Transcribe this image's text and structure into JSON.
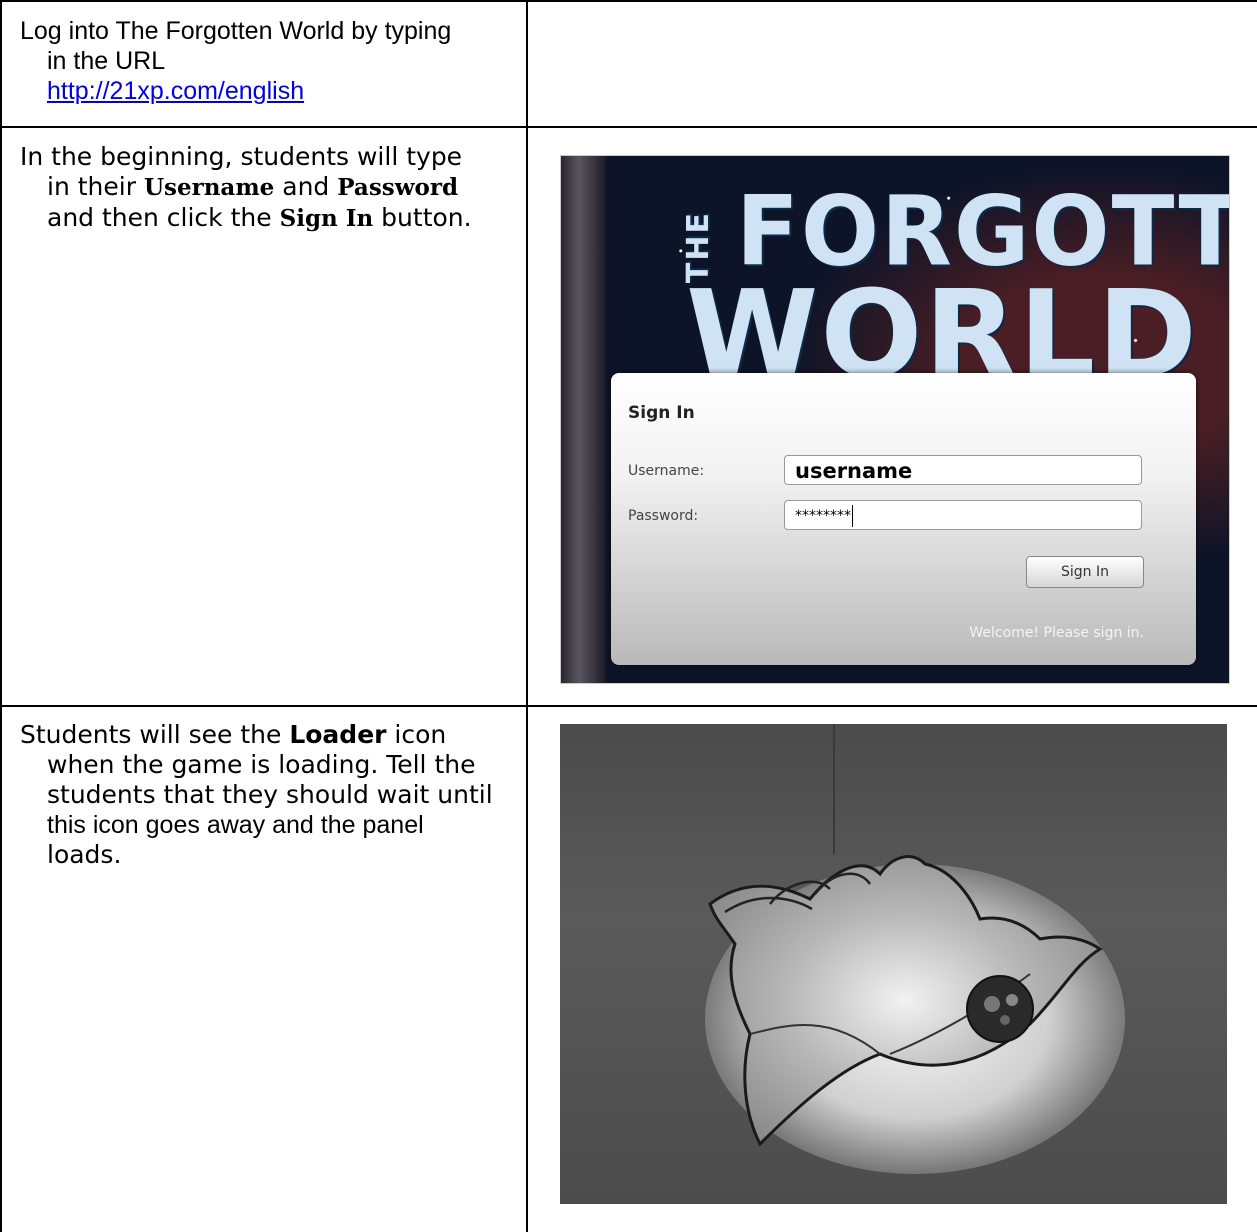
{
  "rows": [
    {
      "text_line1": "Log into The Forgotten World by typing",
      "text_line2": "in the URL",
      "link": "http://21xp.com/english"
    },
    {
      "t1": "In the beginning, students will type",
      "t2a": "in their ",
      "t2b": "Username",
      "t2c": " and ",
      "t2d": "Password",
      "t3a": "and then click the ",
      "t3b": "Sign In",
      "t3c": " button."
    },
    {
      "t1a": "Students will see the ",
      "t1b": "Loader",
      "t1c": " icon",
      "t2": "when the game is loading. Tell the",
      "t3": "students that they should wait until",
      "t4": "this icon goes away and the panel",
      "t5": "loads."
    }
  ],
  "login_screenshot": {
    "title_art_1": "THE",
    "title_art_2": "FORGOTTEN",
    "title_art_3": "WORLD",
    "dialog_title": "Sign In",
    "username_label": "Username:",
    "username_value": "username",
    "password_label": "Password:",
    "password_value": "********",
    "button_label": "Sign In",
    "status": "Welcome! Please sign in."
  },
  "loader_screenshot": {
    "icon": "loader-icon"
  }
}
